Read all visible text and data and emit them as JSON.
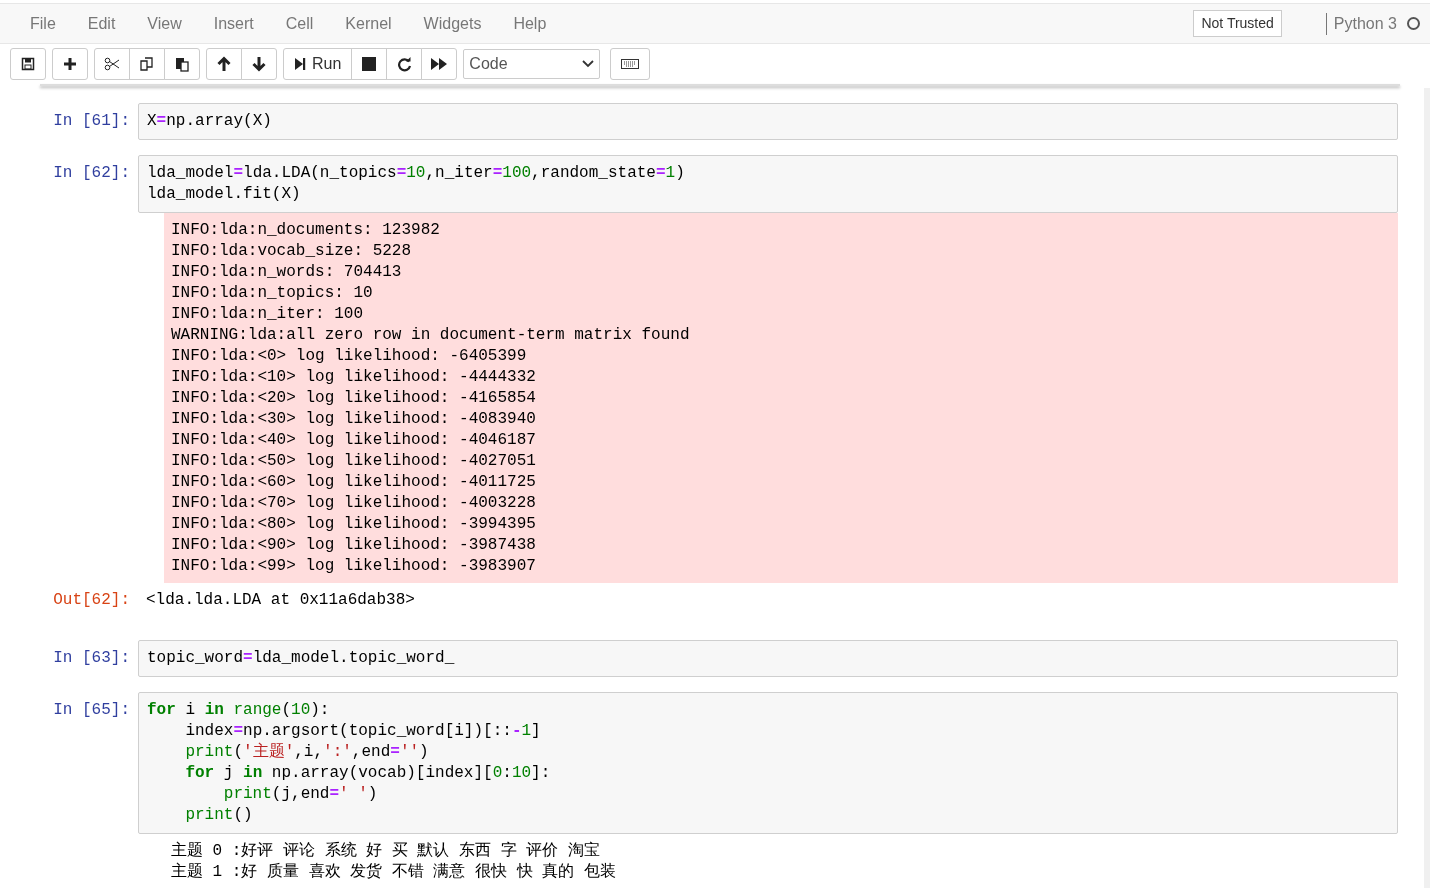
{
  "menu": [
    "File",
    "Edit",
    "View",
    "Insert",
    "Cell",
    "Kernel",
    "Widgets",
    "Help"
  ],
  "trust_badge": "Not Trusted",
  "kernel": {
    "name": "Python 3",
    "busy": false
  },
  "toolbar": [
    {
      "kind": "save"
    },
    {
      "kind": "add"
    },
    {
      "kind": "cut"
    },
    {
      "kind": "copy"
    },
    {
      "kind": "paste"
    },
    {
      "kind": "up"
    },
    {
      "kind": "down"
    },
    {
      "kind": "run",
      "label": "Run"
    },
    {
      "kind": "stop"
    },
    {
      "kind": "restart"
    },
    {
      "kind": "runall"
    }
  ],
  "cell_type": "Code",
  "cells": [
    {
      "prompt": "In [61]:",
      "lines": [
        [
          {
            "kind": "plain",
            "s": "X"
          },
          {
            "kind": "operator",
            "s": "="
          },
          {
            "kind": "plain",
            "s": "np.array(X)"
          }
        ]
      ]
    },
    {
      "prompt": "In [62]:",
      "lines": [
        [
          {
            "kind": "plain",
            "s": "lda_model"
          },
          {
            "kind": "operator",
            "s": "="
          },
          {
            "kind": "plain",
            "s": "lda.LDA(n_topics"
          },
          {
            "kind": "operator",
            "s": "="
          },
          {
            "kind": "number",
            "s": "10"
          },
          {
            "kind": "plain",
            "s": ",n_iter"
          },
          {
            "kind": "operator",
            "s": "="
          },
          {
            "kind": "number",
            "s": "100"
          },
          {
            "kind": "plain",
            "s": ",random_state"
          },
          {
            "kind": "operator",
            "s": "="
          },
          {
            "kind": "number",
            "s": "1"
          },
          {
            "kind": "plain",
            "s": ")"
          }
        ],
        [
          {
            "kind": "plain",
            "s": "lda_model.fit(X)"
          }
        ]
      ],
      "outputs": [
        {
          "kind": "stderr",
          "lines": [
            "INFO:lda:n_documents: 123982",
            "INFO:lda:vocab_size: 5228",
            "INFO:lda:n_words: 704413",
            "INFO:lda:n_topics: 10",
            "INFO:lda:n_iter: 100",
            "WARNING:lda:all zero row in document-term matrix found",
            "INFO:lda:<0> log likelihood: -6405399",
            "INFO:lda:<10> log likelihood: -4444332",
            "INFO:lda:<20> log likelihood: -4165854",
            "INFO:lda:<30> log likelihood: -4083940",
            "INFO:lda:<40> log likelihood: -4046187",
            "INFO:lda:<50> log likelihood: -4027051",
            "INFO:lda:<60> log likelihood: -4011725",
            "INFO:lda:<70> log likelihood: -4003228",
            "INFO:lda:<80> log likelihood: -3994395",
            "INFO:lda:<90> log likelihood: -3987438",
            "INFO:lda:<99> log likelihood: -3983907"
          ]
        },
        {
          "kind": "result",
          "prompt": "Out[62]:",
          "lines": [
            "<lda.lda.LDA at 0x11a6dab38>"
          ]
        }
      ]
    },
    {
      "prompt": "In [63]:",
      "lines": [
        [
          {
            "kind": "plain",
            "s": "topic_word"
          },
          {
            "kind": "operator",
            "s": "="
          },
          {
            "kind": "plain",
            "s": "lda_model.topic_word_"
          }
        ]
      ]
    },
    {
      "prompt": "In [65]:",
      "lines": [
        [
          {
            "kind": "keyword",
            "s": "for"
          },
          {
            "kind": "plain",
            "s": " i "
          },
          {
            "kind": "keyword",
            "s": "in"
          },
          {
            "kind": "builtin",
            "s": " range"
          },
          {
            "kind": "plain",
            "s": "("
          },
          {
            "kind": "number",
            "s": "10"
          },
          {
            "kind": "plain",
            "s": "):"
          }
        ],
        [
          {
            "kind": "plain",
            "s": "    index"
          },
          {
            "kind": "operator",
            "s": "="
          },
          {
            "kind": "plain",
            "s": "np.argsort(topic_word[i])[::"
          },
          {
            "kind": "operator",
            "s": "-"
          },
          {
            "kind": "number",
            "s": "1"
          },
          {
            "kind": "plain",
            "s": "]"
          }
        ],
        [
          {
            "kind": "builtin",
            "s": "    print"
          },
          {
            "kind": "plain",
            "s": "("
          },
          {
            "kind": "string",
            "s": "'主题'"
          },
          {
            "kind": "plain",
            "s": ",i,"
          },
          {
            "kind": "string",
            "s": "':'"
          },
          {
            "kind": "plain",
            "s": ",end"
          },
          {
            "kind": "operator",
            "s": "="
          },
          {
            "kind": "string",
            "s": "''"
          },
          {
            "kind": "plain",
            "s": ")"
          }
        ],
        [
          {
            "kind": "keyword",
            "s": "    for"
          },
          {
            "kind": "plain",
            "s": " j "
          },
          {
            "kind": "keyword",
            "s": "in"
          },
          {
            "kind": "plain",
            "s": " np.array(vocab)[index]["
          },
          {
            "kind": "number",
            "s": "0"
          },
          {
            "kind": "plain",
            "s": ":"
          },
          {
            "kind": "number",
            "s": "10"
          },
          {
            "kind": "plain",
            "s": "]:"
          }
        ],
        [
          {
            "kind": "builtin",
            "s": "        print"
          },
          {
            "kind": "plain",
            "s": "(j,end"
          },
          {
            "kind": "operator",
            "s": "="
          },
          {
            "kind": "string",
            "s": "' '"
          },
          {
            "kind": "plain",
            "s": ")"
          }
        ],
        [
          {
            "kind": "builtin",
            "s": "    print"
          },
          {
            "kind": "plain",
            "s": "()"
          }
        ]
      ],
      "outputs": [
        {
          "kind": "stdout",
          "lines": [
            "主题 0 :好评 评论 系统 好 买 默认 东西 字 评价 淘宝",
            "主题 1 :好 质量 喜欢 发货 不错 满意 很快 快 真的 包装"
          ]
        }
      ]
    }
  ]
}
